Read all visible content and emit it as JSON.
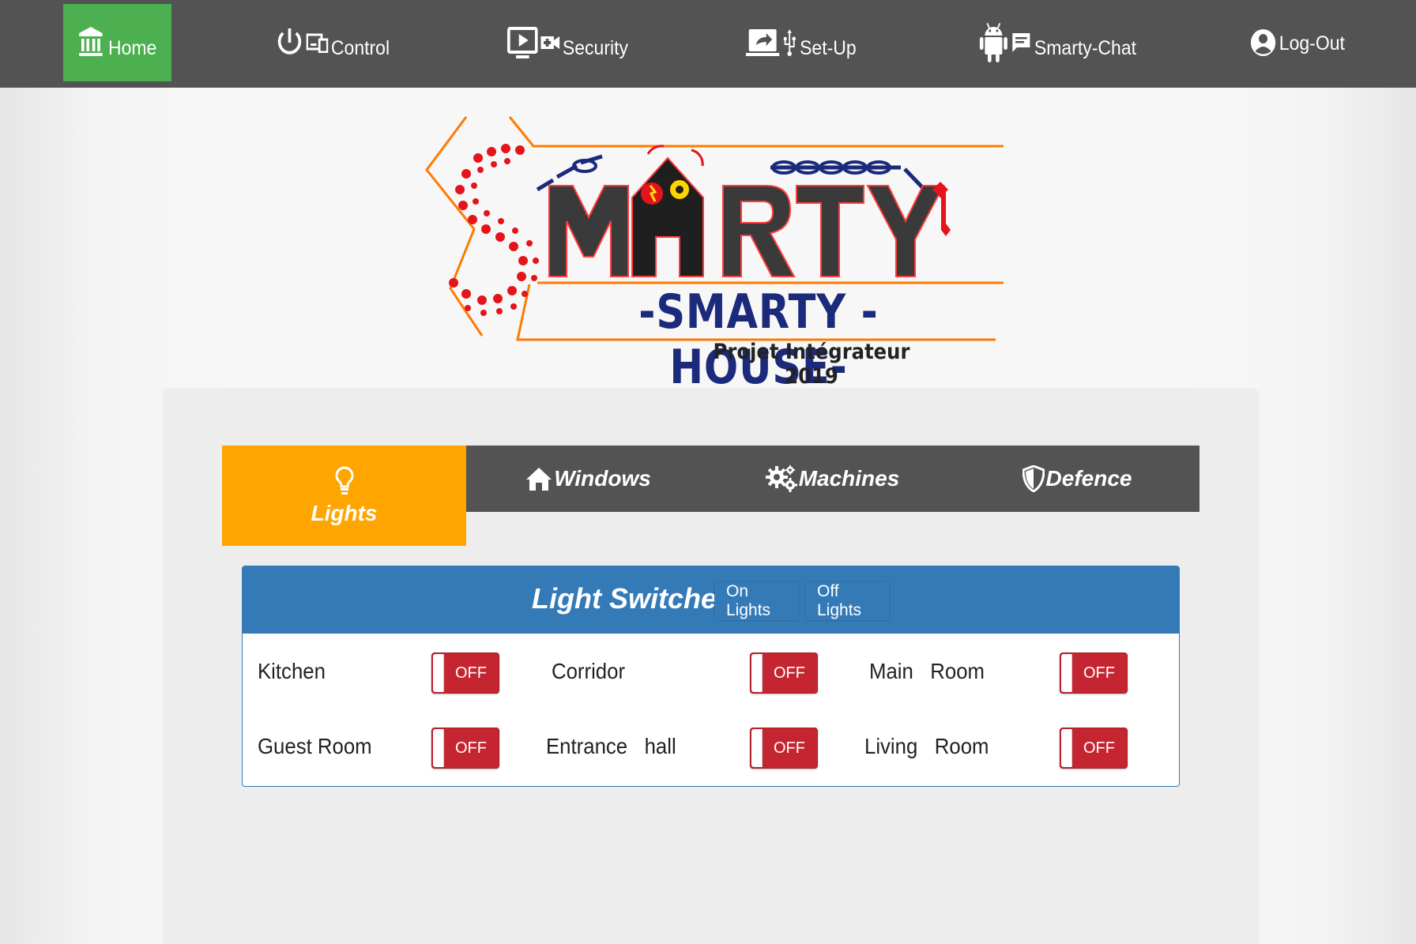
{
  "nav": {
    "home": "Home",
    "control": "Control",
    "security": "Security",
    "setup": "Set-Up",
    "chat": "Smarty-Chat",
    "logout": "Log-Out"
  },
  "logo": {
    "banner": "-SMARTY - HOUSE-",
    "subtitle": "Projet Intégrateur 2019"
  },
  "tabs": {
    "lights": "Lights",
    "windows": "Windows",
    "machines": "Machines",
    "defence": "Defence"
  },
  "panel": {
    "title": "Light Switches",
    "on_button": "On Lights",
    "off_button": "Off Lights"
  },
  "switches": [
    {
      "label": "Kitchen",
      "state": "OFF"
    },
    {
      "label": "Corridor",
      "state": "OFF"
    },
    {
      "label": "Main   Room",
      "state": "OFF"
    },
    {
      "label": "Guest Room",
      "state": "OFF"
    },
    {
      "label": "Entrance   hall",
      "state": "OFF"
    },
    {
      "label": "Living   Room",
      "state": "OFF"
    }
  ],
  "colors": {
    "nav_bg": "#535353",
    "home_active": "#4caf50",
    "tab_active": "#ffa500",
    "panel_header": "#337ab7",
    "toggle_off": "#c52531"
  }
}
